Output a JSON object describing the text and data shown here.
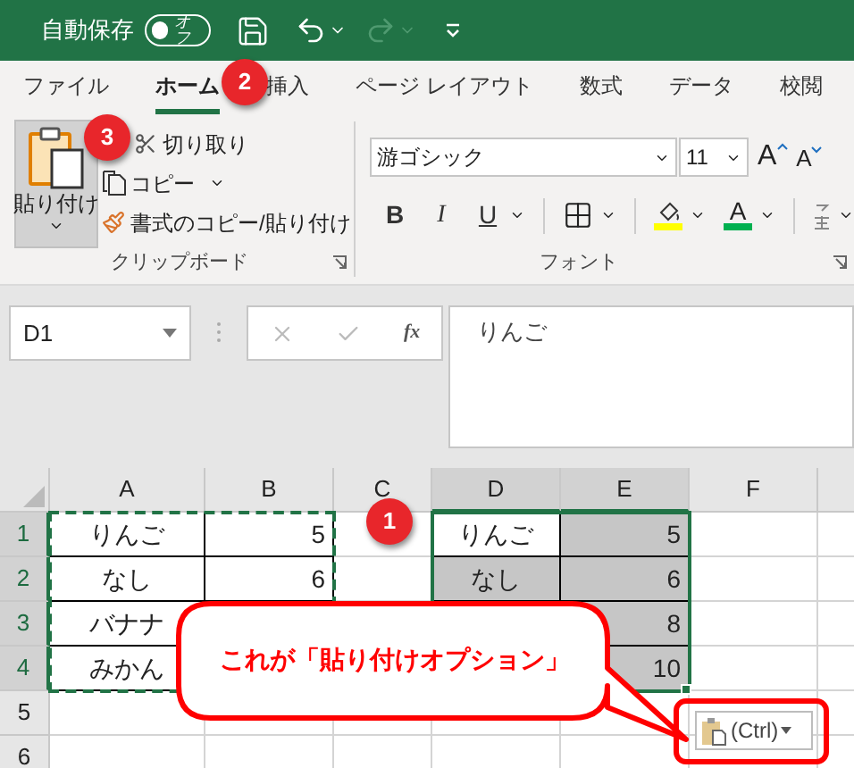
{
  "title_bar": {
    "autosave_label": "自動保存",
    "autosave_toggle": {
      "label": "オフ",
      "on": false
    },
    "redo_disabled": true
  },
  "tabs": [
    {
      "label": "ファイル",
      "selected": false
    },
    {
      "label": "ホーム",
      "selected": true
    },
    {
      "label": "挿入",
      "selected": false
    },
    {
      "label": "ページ レイアウト",
      "selected": false
    },
    {
      "label": "数式",
      "selected": false
    },
    {
      "label": "データ",
      "selected": false
    },
    {
      "label": "校閲",
      "selected": false
    }
  ],
  "clipboard_group": {
    "paste": {
      "label": "貼り付け",
      "selected": true
    },
    "cut": "切り取り",
    "copy": "コピー",
    "format_painter": "書式のコピー/貼り付け",
    "group_label": "クリップボード"
  },
  "font_group": {
    "font_name": "游ゴシック",
    "font_size": "11",
    "grow": "A",
    "shrink": "A",
    "style_buttons": [
      {
        "kind": "bold",
        "label": "B"
      },
      {
        "kind": "italic",
        "label": "I"
      },
      {
        "kind": "underline",
        "label": "U"
      }
    ],
    "font_color": {
      "label": "A"
    },
    "group_label": "フォント"
  },
  "formula_bar": {
    "name_box": "D1",
    "fx": "fx",
    "content": "りんご"
  },
  "columns": [
    {
      "label": "A",
      "selected": false
    },
    {
      "label": "B",
      "selected": false
    },
    {
      "label": "C",
      "selected": false
    },
    {
      "label": "D",
      "selected": true
    },
    {
      "label": "E",
      "selected": true
    },
    {
      "label": "F",
      "selected": false
    }
  ],
  "rows": [
    {
      "header": "1",
      "selected": true,
      "cells": [
        {
          "text": "りんご",
          "kind": "text",
          "bordered": true,
          "highlighted": false
        },
        {
          "text": "5",
          "kind": "number",
          "bordered": true,
          "highlighted": false
        },
        null,
        {
          "text": "りんご",
          "kind": "text",
          "bordered": true,
          "highlighted": false
        },
        {
          "text": "5",
          "kind": "number",
          "bordered": true,
          "highlighted": true
        },
        null
      ]
    },
    {
      "header": "2",
      "selected": true,
      "cells": [
        {
          "text": "なし",
          "kind": "text",
          "bordered": true,
          "highlighted": false
        },
        {
          "text": "6",
          "kind": "number",
          "bordered": true,
          "highlighted": false
        },
        null,
        {
          "text": "なし",
          "kind": "text",
          "bordered": true,
          "highlighted": true
        },
        {
          "text": "6",
          "kind": "number",
          "bordered": true,
          "highlighted": true
        },
        null
      ]
    },
    {
      "header": "3",
      "selected": true,
      "cells": [
        {
          "text": "バナナ",
          "kind": "text",
          "bordered": true,
          "highlighted": false
        },
        null,
        null,
        null,
        {
          "text": "8",
          "kind": "number",
          "bordered": true,
          "highlighted": true
        },
        null
      ]
    },
    {
      "header": "4",
      "selected": true,
      "cells": [
        {
          "text": "みかん",
          "kind": "text",
          "bordered": true,
          "highlighted": false
        },
        null,
        null,
        null,
        {
          "text": "10",
          "kind": "number",
          "bordered": true,
          "highlighted": true
        },
        null
      ]
    },
    {
      "header": "5",
      "selected": false,
      "cells": [
        null,
        null,
        null,
        null,
        null,
        null
      ]
    },
    {
      "header": "6",
      "selected": false,
      "cells": [
        null,
        null,
        null,
        null,
        null,
        null
      ]
    }
  ],
  "paste_options": {
    "label": "(Ctrl)"
  },
  "callout": {
    "text": "これが「貼り付けオプション」"
  },
  "badges": [
    {
      "label": "1"
    },
    {
      "label": "2"
    },
    {
      "label": "3"
    }
  ]
}
